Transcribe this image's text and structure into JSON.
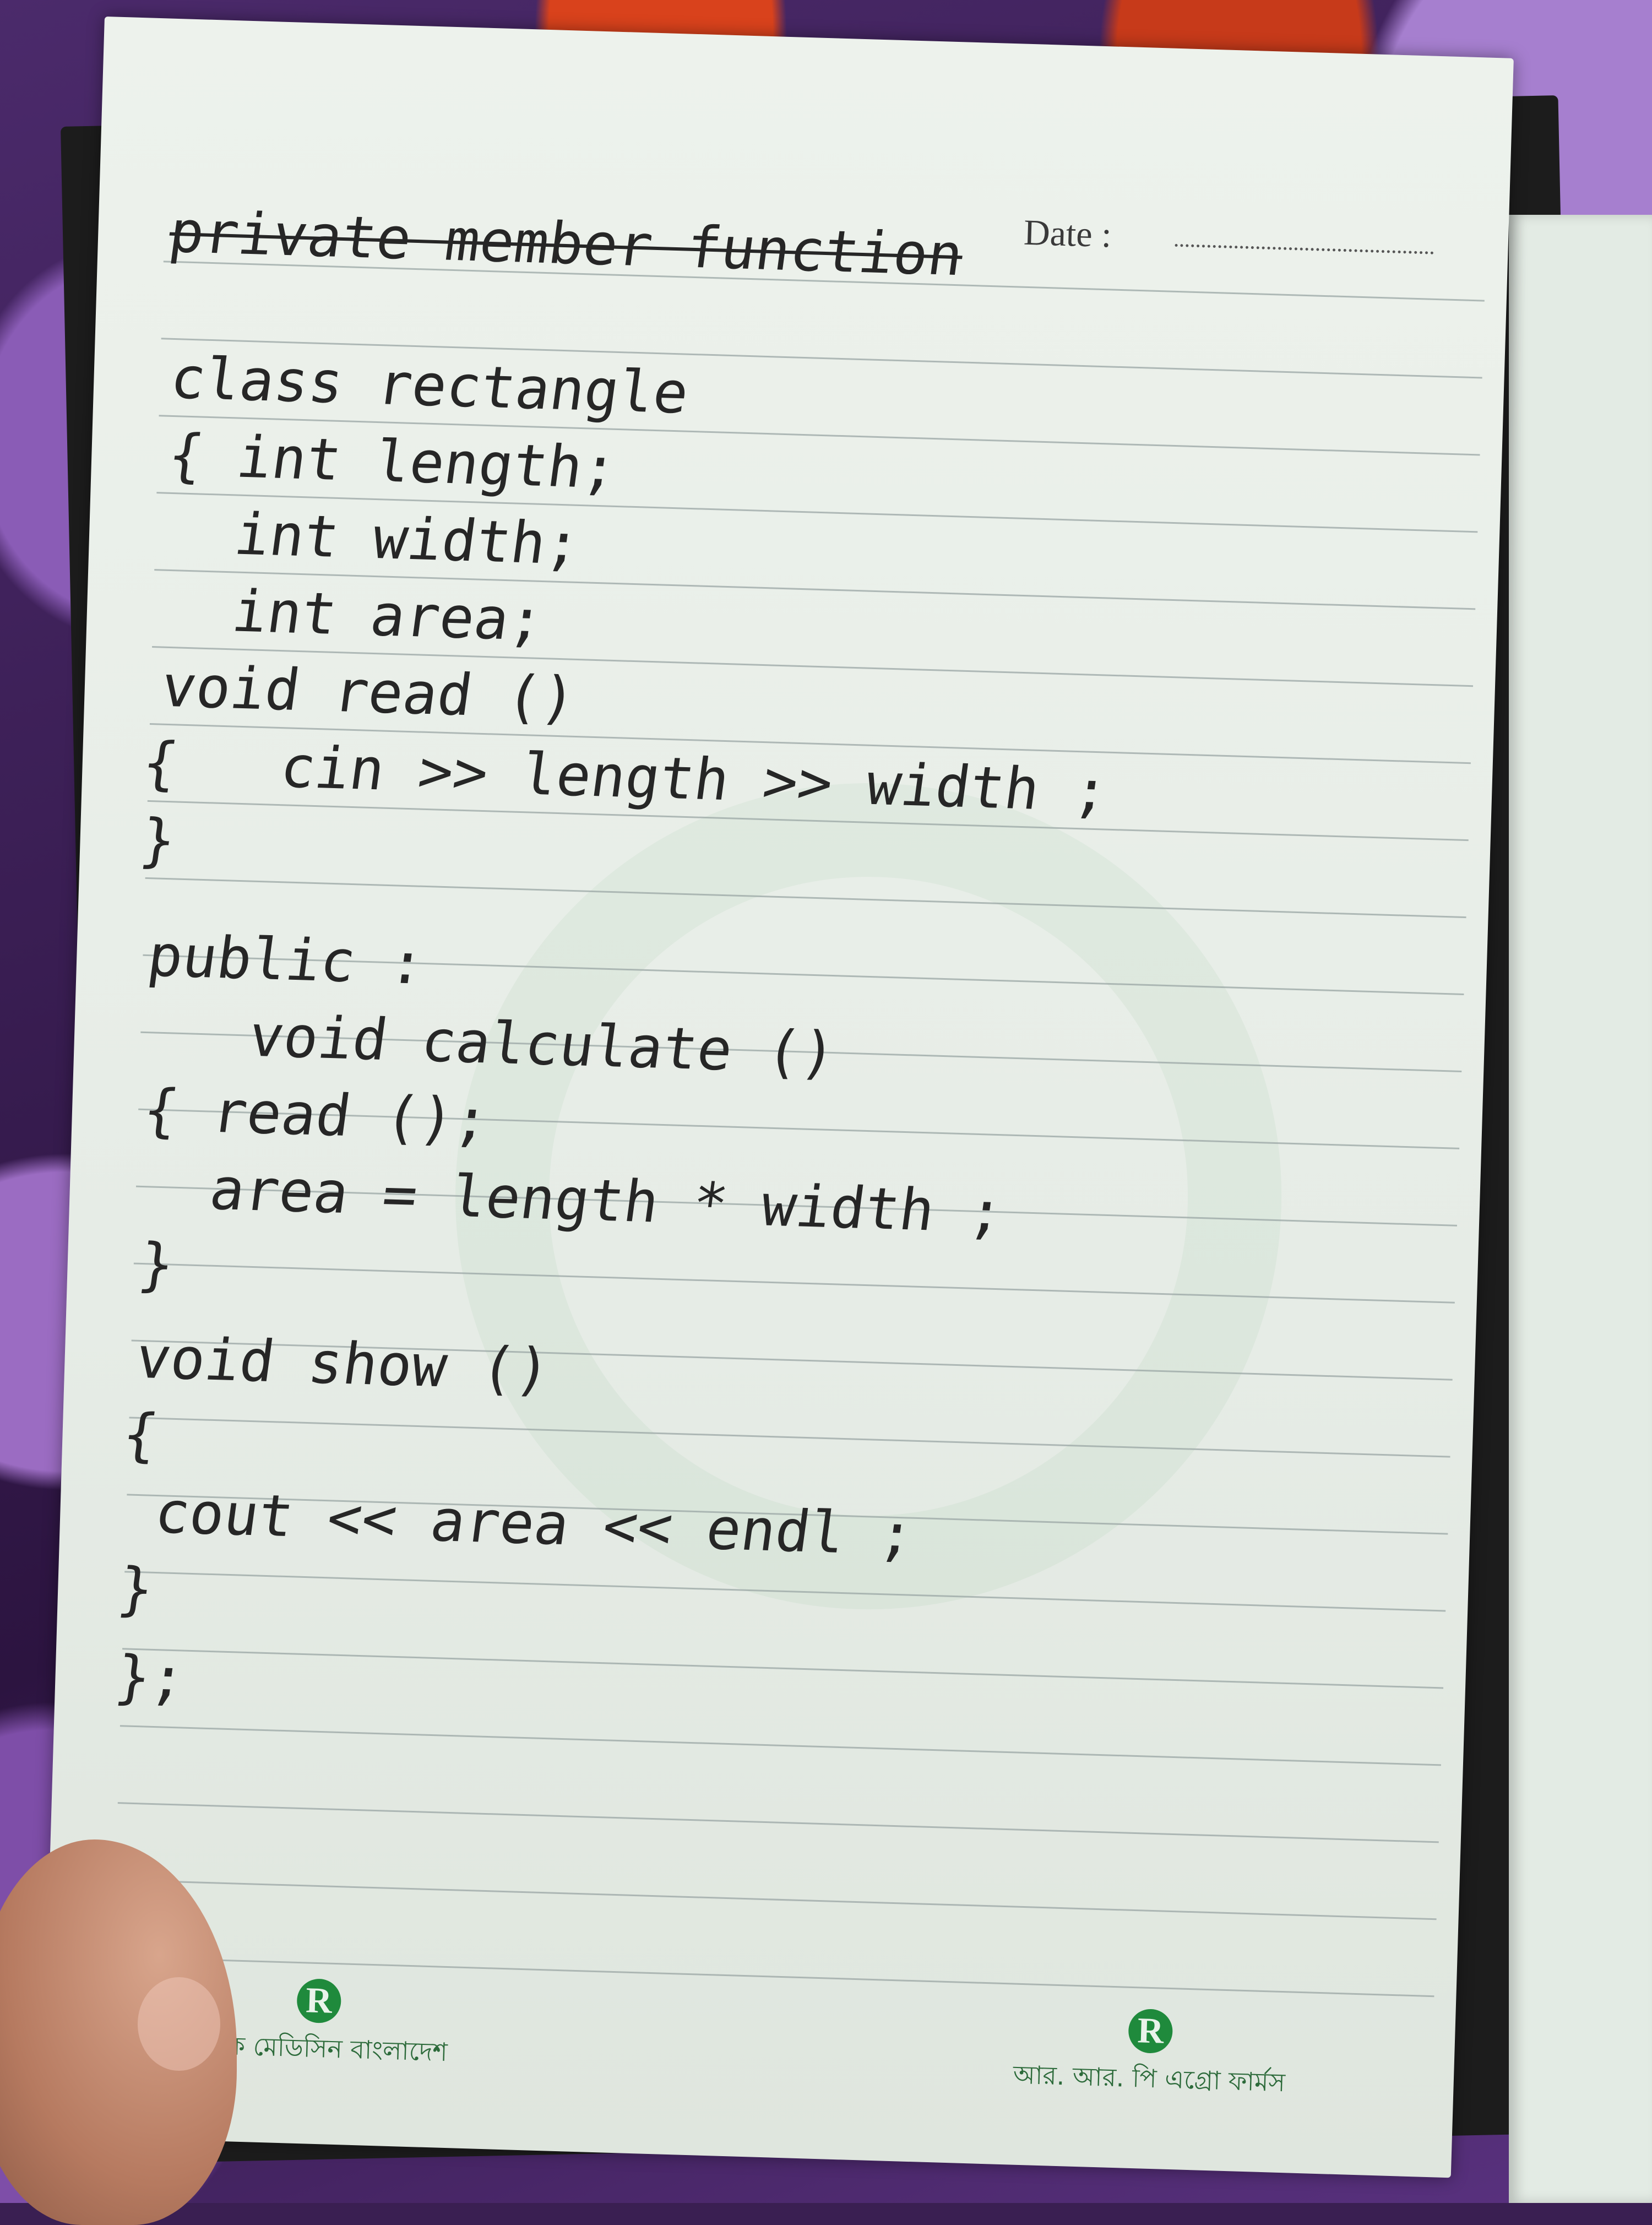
{
  "header": {
    "date_label": "Date :"
  },
  "notes": {
    "heading": "private member function",
    "lines": [
      "class rectangle",
      "{ int length;",
      "  int width;",
      "  int area;",
      "void read ()",
      "{   cin >> length >> width ;",
      "}",
      "public :",
      "   void calculate ()",
      "{ read ();",
      "  area = length * width ;",
      "}",
      "void show ()",
      "{",
      " cout << area << endl ;",
      "}",
      "};"
    ]
  },
  "footer": {
    "logo_left_mark": "R",
    "logo_left_text": "রফিক মেডিসিন বাংলাদেশ",
    "logo_right_mark": "R",
    "logo_right_text": "আর. আর. পি এগ্রো ফার্মস"
  },
  "colors": {
    "ink": "#262626",
    "paper": "#eaf0e9",
    "rule": "#9aa6a4",
    "logo_green": "#1f8a3c",
    "background_purple": "#3a1f52"
  }
}
